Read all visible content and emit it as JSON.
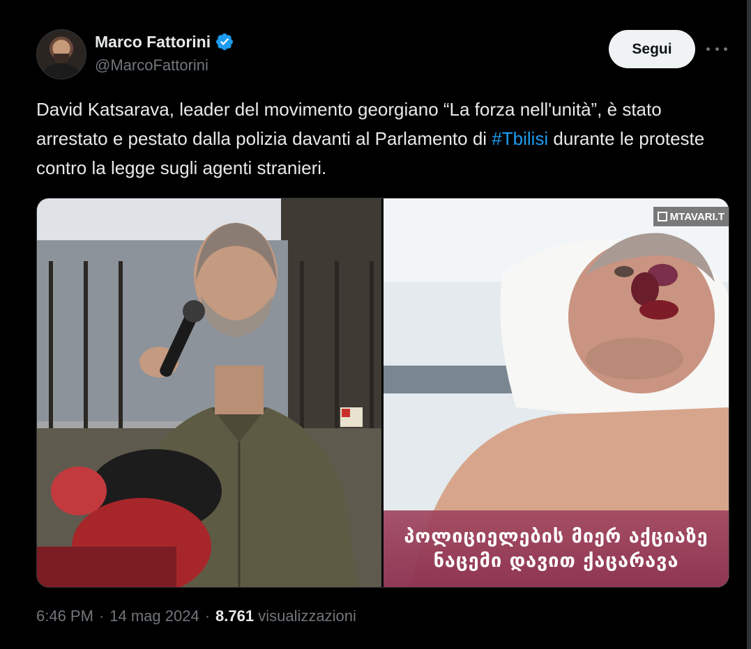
{
  "author": {
    "display_name": "Marco Fattorini",
    "handle": "@MarcoFattorini",
    "verified": true,
    "avatar_icon": "user-avatar"
  },
  "actions": {
    "follow_label": "Segui",
    "more_icon": "more-horizontal-icon"
  },
  "tweet": {
    "text_part1": "David Katsarava, leader del movimento georgiano “La forza nell'unità”, è stato arrestato e pestato dalla polizia davanti al Parlamento di ",
    "hashtag": "#Tbilisi",
    "text_part2": " durante le proteste contro la legge sugli agenti stranieri."
  },
  "media": {
    "right_watermark": "MTAVARI.T",
    "caption_line1": "პოლიციელების მიერ აქციაზე",
    "caption_line2": "ნაცემი დავით ქაცარავა"
  },
  "meta": {
    "time": "6:46 PM",
    "date": "14 mag 2024",
    "views_count": "8.761",
    "views_label": "visualizzazioni"
  },
  "colors": {
    "background": "#000000",
    "text": "#e7e9ea",
    "secondary": "#71767b",
    "link": "#1d9bf0",
    "verified": "#1d9bf0",
    "follow_bg": "#eff3f4"
  }
}
